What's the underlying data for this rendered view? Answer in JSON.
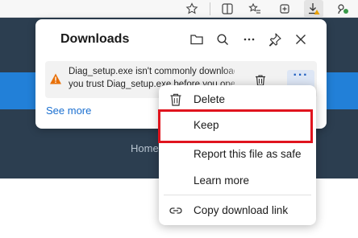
{
  "browser_toolbar": {
    "icons": [
      "star-icon",
      "split-screen-icon",
      "favorites-icon",
      "collections-icon",
      "downloads-icon",
      "extension-icon"
    ]
  },
  "page": {
    "footer_link": "Home"
  },
  "downloads_panel": {
    "title": "Downloads",
    "item": {
      "line1": "Diag_setup.exe isn't commonly downloaded. Make sure",
      "line2": "you trust Diag_setup.exe before you open it.",
      "more_label": "···"
    },
    "see_more": "See more"
  },
  "context_menu": {
    "items": [
      {
        "label": "Delete",
        "icon": "trash-icon"
      },
      {
        "label": "Keep",
        "icon": ""
      },
      {
        "label": "Report this file as safe",
        "icon": ""
      },
      {
        "label": "Learn more",
        "icon": ""
      },
      {
        "label": "Copy download link",
        "icon": "link-icon"
      }
    ],
    "highlighted": "Keep",
    "highlight_color": "#e0141e"
  },
  "colors": {
    "page_dark": "#2c3e50",
    "page_blue": "#2280d8",
    "warning": "#e8710a",
    "link": "#1a6fd0"
  }
}
